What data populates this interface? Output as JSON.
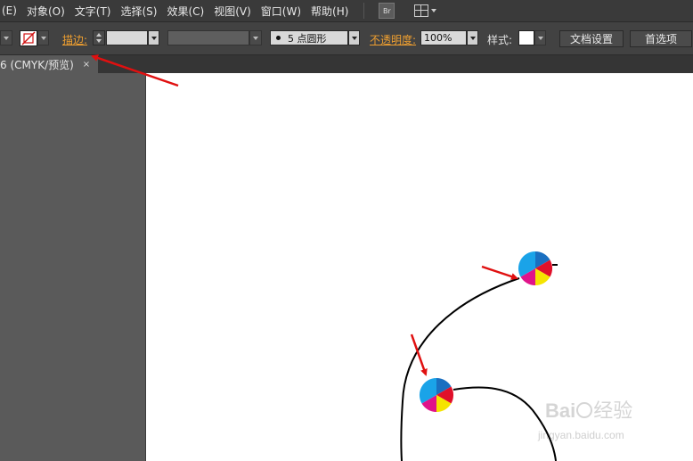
{
  "menu": {
    "items": [
      "(E)",
      "对象(O)",
      "文字(T)",
      "选择(S)",
      "效果(C)",
      "视图(V)",
      "窗口(W)",
      "帮助(H)"
    ],
    "bridge_label": "Br"
  },
  "control": {
    "stroke_label": "描边:",
    "brush_value": "5 点圆形",
    "opacity_label": "不透明度:",
    "opacity_value": "100%",
    "style_label": "样式:",
    "doc_setup_button": "文档设置",
    "prefs_button": "首选项"
  },
  "tab": {
    "title": "6 (CMYK/预览)",
    "close_glyph": "×"
  },
  "watermark": {
    "brand_left": "Bai",
    "brand_right": "经验",
    "url": "jingyan.baidu.com"
  },
  "colors": {
    "annotation_arrow": "#e01010",
    "anchor_cyan": "#1aa3e8",
    "anchor_blue": "#1a6fc0",
    "anchor_red": "#e0102a",
    "anchor_yellow": "#f5e400",
    "anchor_magenta": "#e0148a"
  }
}
